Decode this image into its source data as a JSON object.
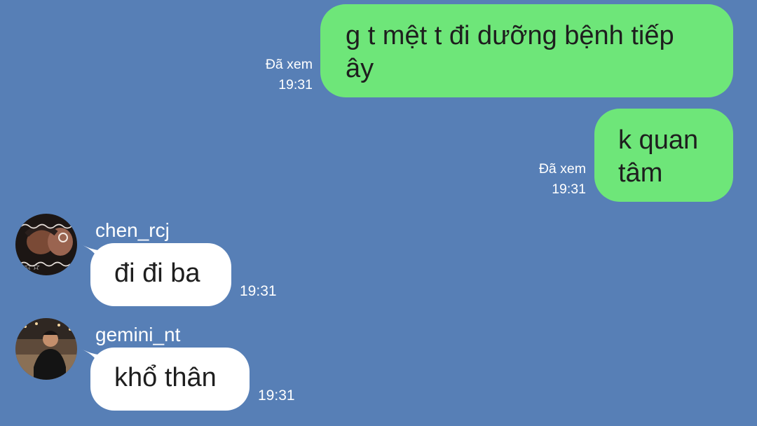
{
  "theme": {
    "background": "#577fb6",
    "outgoing_bubble": "#6ee679",
    "incoming_bubble": "#ffffff",
    "meta_text": "#ffffff"
  },
  "outgoing": [
    {
      "lines": [
        "g t mệt t đi dưỡng bệnh tiếp",
        "ây"
      ],
      "status": "Đã xem",
      "time": "19:31"
    },
    {
      "lines": [
        "k quan",
        "tâm"
      ],
      "status": "Đã xem",
      "time": "19:31"
    }
  ],
  "incoming": [
    {
      "sender": "chen_rcj",
      "text": "đi đi ba",
      "time": "19:31",
      "avatar_icon": "user-photo-icon"
    },
    {
      "sender": "gemini_nt",
      "text": "khổ thân",
      "time": "19:31",
      "avatar_icon": "user-photo-icon"
    }
  ]
}
